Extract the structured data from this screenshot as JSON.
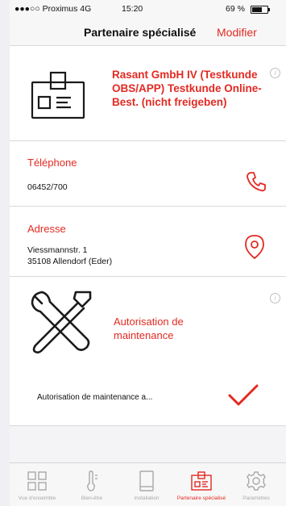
{
  "status_bar": {
    "carrier": "●●●○○ Proximus  4G",
    "time": "15:20",
    "battery": "69 %",
    "battery_level": 0.69
  },
  "nav": {
    "title": "Partenaire spécialisé",
    "modify_label": "Modifier"
  },
  "partner": {
    "name": "Rasant GmbH IV (Testkunde OBS/APP) Testkunde Online-Best. (nicht freigeben)",
    "icon": "id-badge-icon"
  },
  "phone": {
    "label": "Téléphone",
    "value": "06452/700",
    "icon": "phone-icon"
  },
  "address": {
    "label": "Adresse",
    "line1": "Viessmannstr. 1",
    "line2": "35108 Allendorf (Eder)",
    "icon": "location-pin-icon"
  },
  "maintenance": {
    "title": "Autorisation de maintenance",
    "status_text": "Autorisation de maintenance a...",
    "icon": "tools-icon",
    "check_icon": "checkmark-icon"
  },
  "tabbar": {
    "tabs": [
      {
        "label": "Vue d'ensemble",
        "icon": "grid-icon",
        "active": false
      },
      {
        "label": "Bien-être",
        "icon": "thermometer-icon",
        "active": false
      },
      {
        "label": "Installation",
        "icon": "tablet-icon",
        "active": false
      },
      {
        "label": "Partenaire spécialisé",
        "icon": "id-badge-icon",
        "active": true
      },
      {
        "label": "Paramètres",
        "icon": "gear-icon",
        "active": false
      }
    ]
  },
  "colors": {
    "accent": "#e32a22",
    "text": "#111111",
    "inactive": "#a8a8a8"
  }
}
